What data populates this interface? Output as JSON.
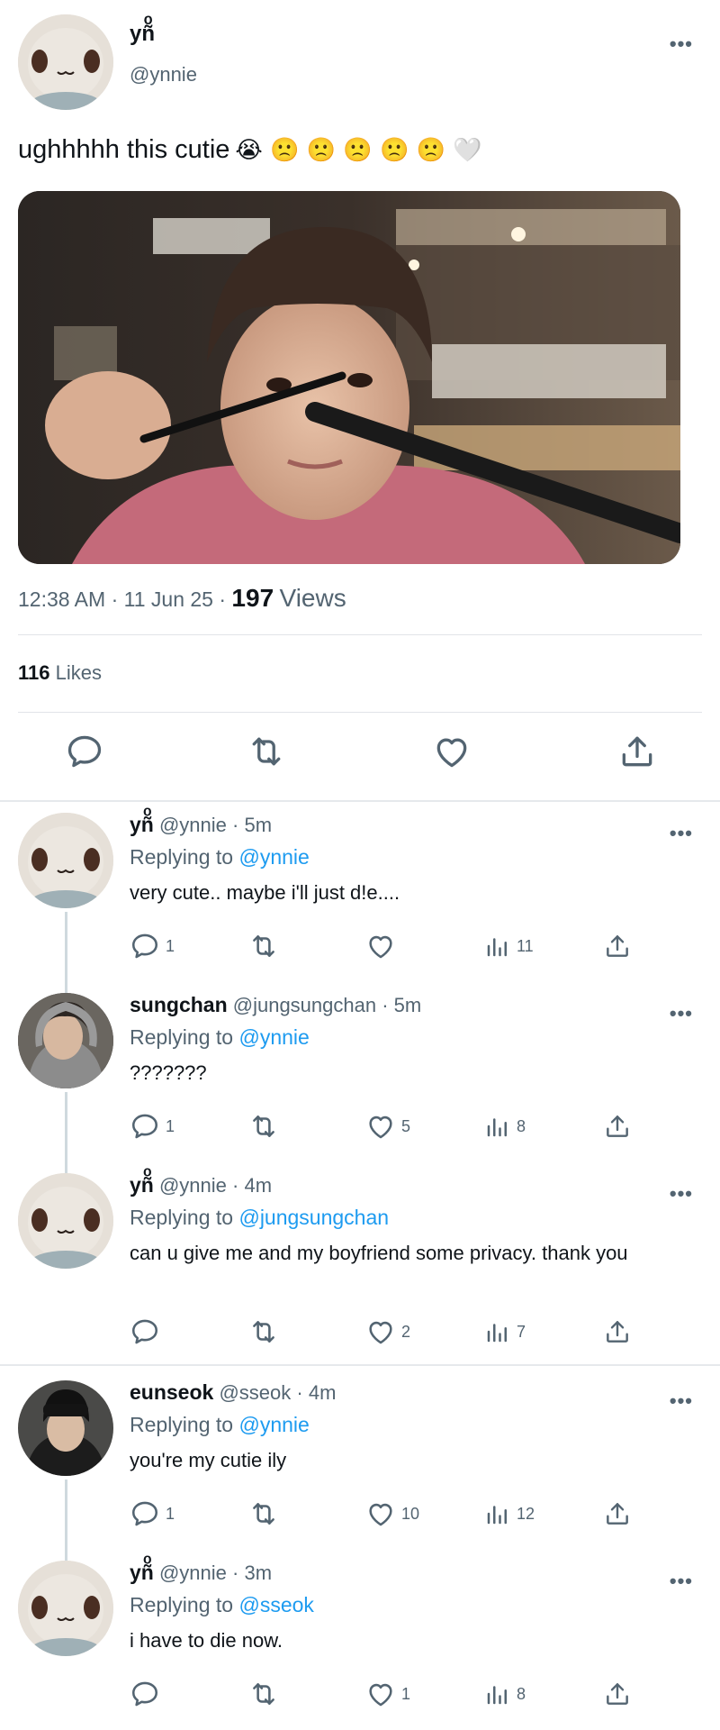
{
  "main": {
    "name": "yñͦ",
    "handle": "@ynnie",
    "more": "•••",
    "text": "ughhhhh this cutie",
    "emojis": "😭 🙁 🙁 🙁 🙁 🙁 🤍",
    "time": "12:38 AM",
    "sep1": "·",
    "date": "11 Jun 25",
    "sep2": "·",
    "views_count": "197",
    "views_label": "Views",
    "likes_count": "116",
    "likes_label": "Likes"
  },
  "replies": [
    {
      "name": "yñͦ",
      "handle": "@ynnie",
      "time": "· 5m",
      "replying_label": "Replying to",
      "replying_to": "@ynnie",
      "text": "very cute.. maybe i'll just d!e....",
      "reply_count": "1",
      "like_count": "",
      "view_count": "11"
    },
    {
      "name": "sungchan",
      "handle": "@jungsungchan",
      "time": "· 5m",
      "replying_label": "Replying to",
      "replying_to": "@ynnie",
      "text": "???????",
      "reply_count": "1",
      "like_count": "5",
      "view_count": "8"
    },
    {
      "name": "yñͦ",
      "handle": "@ynnie",
      "time": "· 4m",
      "replying_label": "Replying to",
      "replying_to": "@jungsungchan",
      "text": "can u give me and my boyfriend some privacy. thank you",
      "reply_count": "",
      "like_count": "2",
      "view_count": "7"
    },
    {
      "name": "eunseok",
      "handle": "@sseok",
      "time": "· 4m",
      "replying_label": "Replying to",
      "replying_to": "@ynnie",
      "text": "you're my cutie ily",
      "reply_count": "1",
      "like_count": "10",
      "view_count": "12"
    },
    {
      "name": "yñͦ",
      "handle": "@ynnie",
      "time": "· 3m",
      "replying_label": "Replying to",
      "replying_to": "@sseok",
      "text": "i have to die now.",
      "reply_count": "",
      "like_count": "1",
      "view_count": "8"
    }
  ],
  "colors": {
    "accent": "#1d9bf0",
    "text": "#0f1419",
    "secondary": "#536471"
  },
  "icons": {
    "reply": "reply-icon",
    "retweet": "retweet-icon",
    "like": "heart-icon",
    "views": "views-icon",
    "share": "share-icon",
    "more": "more-icon"
  }
}
